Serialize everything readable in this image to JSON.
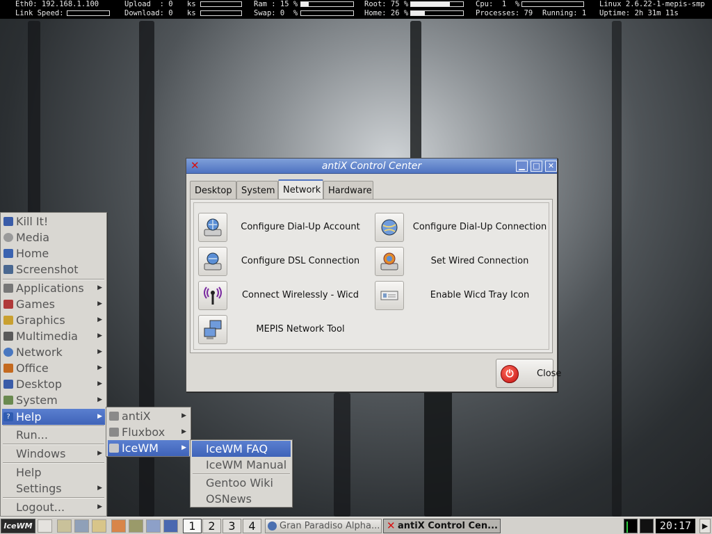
{
  "conky": {
    "eth0": "Eth0: 192.168.1.100",
    "link_speed": "Link Speed:",
    "upload": "Upload  : 0",
    "download": "Download: 0",
    "ks1": "ks",
    "ks2": "ks",
    "ram": "Ram : 15 %",
    "swap": "Swap: 0  %",
    "ram_fraction": 0.15,
    "swap_fraction": 0.0,
    "root": "Root: 75 %",
    "home": "Home: 26 %",
    "root_fraction": 0.75,
    "home_fraction": 0.26,
    "cpu": "Cpu:  1  %",
    "processes": "Processes: 79",
    "running": "Running: 1",
    "kernel": "Linux 2.6.22-1-mepis-smp",
    "uptime": "Uptime: 2h 31m 11s"
  },
  "window": {
    "title": "antiX Control Center",
    "tabs": [
      {
        "label": "Desktop"
      },
      {
        "label": "System"
      },
      {
        "label": "Network",
        "active": true
      },
      {
        "label": "Hardware"
      }
    ],
    "items": [
      {
        "label": "Configure Dial-Up Account",
        "icon": "dialup-account-icon"
      },
      {
        "label": "Configure Dial-Up Connection",
        "icon": "globe-icon"
      },
      {
        "label": "Configure DSL Connection",
        "icon": "dsl-icon"
      },
      {
        "label": "Set Wired Connection",
        "icon": "wired-connection-icon"
      },
      {
        "label": "Connect Wirelessly - Wicd",
        "icon": "wireless-icon"
      },
      {
        "label": "Enable Wicd Tray Icon",
        "icon": "tray-icon"
      },
      {
        "label": "MEPIS Network Tool",
        "icon": "network-tool-icon"
      }
    ],
    "close_label": "Close"
  },
  "start_menu": {
    "items": [
      {
        "label": "Kill It!",
        "icon": "kill-icon"
      },
      {
        "label": "Media",
        "icon": "media-icon"
      },
      {
        "label": "Home",
        "icon": "home-icon"
      },
      {
        "label": "Screenshot",
        "icon": "screenshot-icon"
      },
      {
        "label": "Applications",
        "icon": "applications-icon",
        "submenu": true
      },
      {
        "label": "Games",
        "icon": "games-icon",
        "submenu": true
      },
      {
        "label": "Graphics",
        "icon": "graphics-icon",
        "submenu": true
      },
      {
        "label": "Multimedia",
        "icon": "multimedia-icon",
        "submenu": true
      },
      {
        "label": "Network",
        "icon": "network-icon",
        "submenu": true
      },
      {
        "label": "Office",
        "icon": "office-icon",
        "submenu": true
      },
      {
        "label": "Desktop",
        "icon": "desktop-icon",
        "submenu": true
      },
      {
        "label": "System",
        "icon": "system-icon",
        "submenu": true
      },
      {
        "label": "Help",
        "icon": "help-icon",
        "submenu": true,
        "selected": true
      },
      {
        "label": "Run..."
      },
      {
        "label": "Windows",
        "submenu": true
      },
      {
        "label": "Help"
      },
      {
        "label": "Settings",
        "submenu": true
      },
      {
        "label": "Logout...",
        "submenu": true
      }
    ]
  },
  "help_menu": {
    "items": [
      {
        "label": "antiX"
      },
      {
        "label": "Fluxbox"
      },
      {
        "label": "IceWM",
        "selected": true
      }
    ]
  },
  "icewm_menu": {
    "items": [
      {
        "label": "IceWM FAQ",
        "selected": true
      },
      {
        "label": "IceWM Manual"
      },
      {
        "label": "Gentoo Wiki"
      },
      {
        "label": "OSNews"
      }
    ]
  },
  "taskbar": {
    "start_label": "IceWM",
    "workspaces": [
      "1",
      "2",
      "3",
      "4"
    ],
    "tasks": [
      {
        "label": "Gran Paradiso Alpha..."
      },
      {
        "label": "antiX Control Cen...",
        "active": true
      }
    ],
    "clock": "20:17"
  },
  "colors": {
    "accent": "#4f73c1",
    "menu_bg": "#d9d7d2",
    "close_red": "#c21010"
  }
}
